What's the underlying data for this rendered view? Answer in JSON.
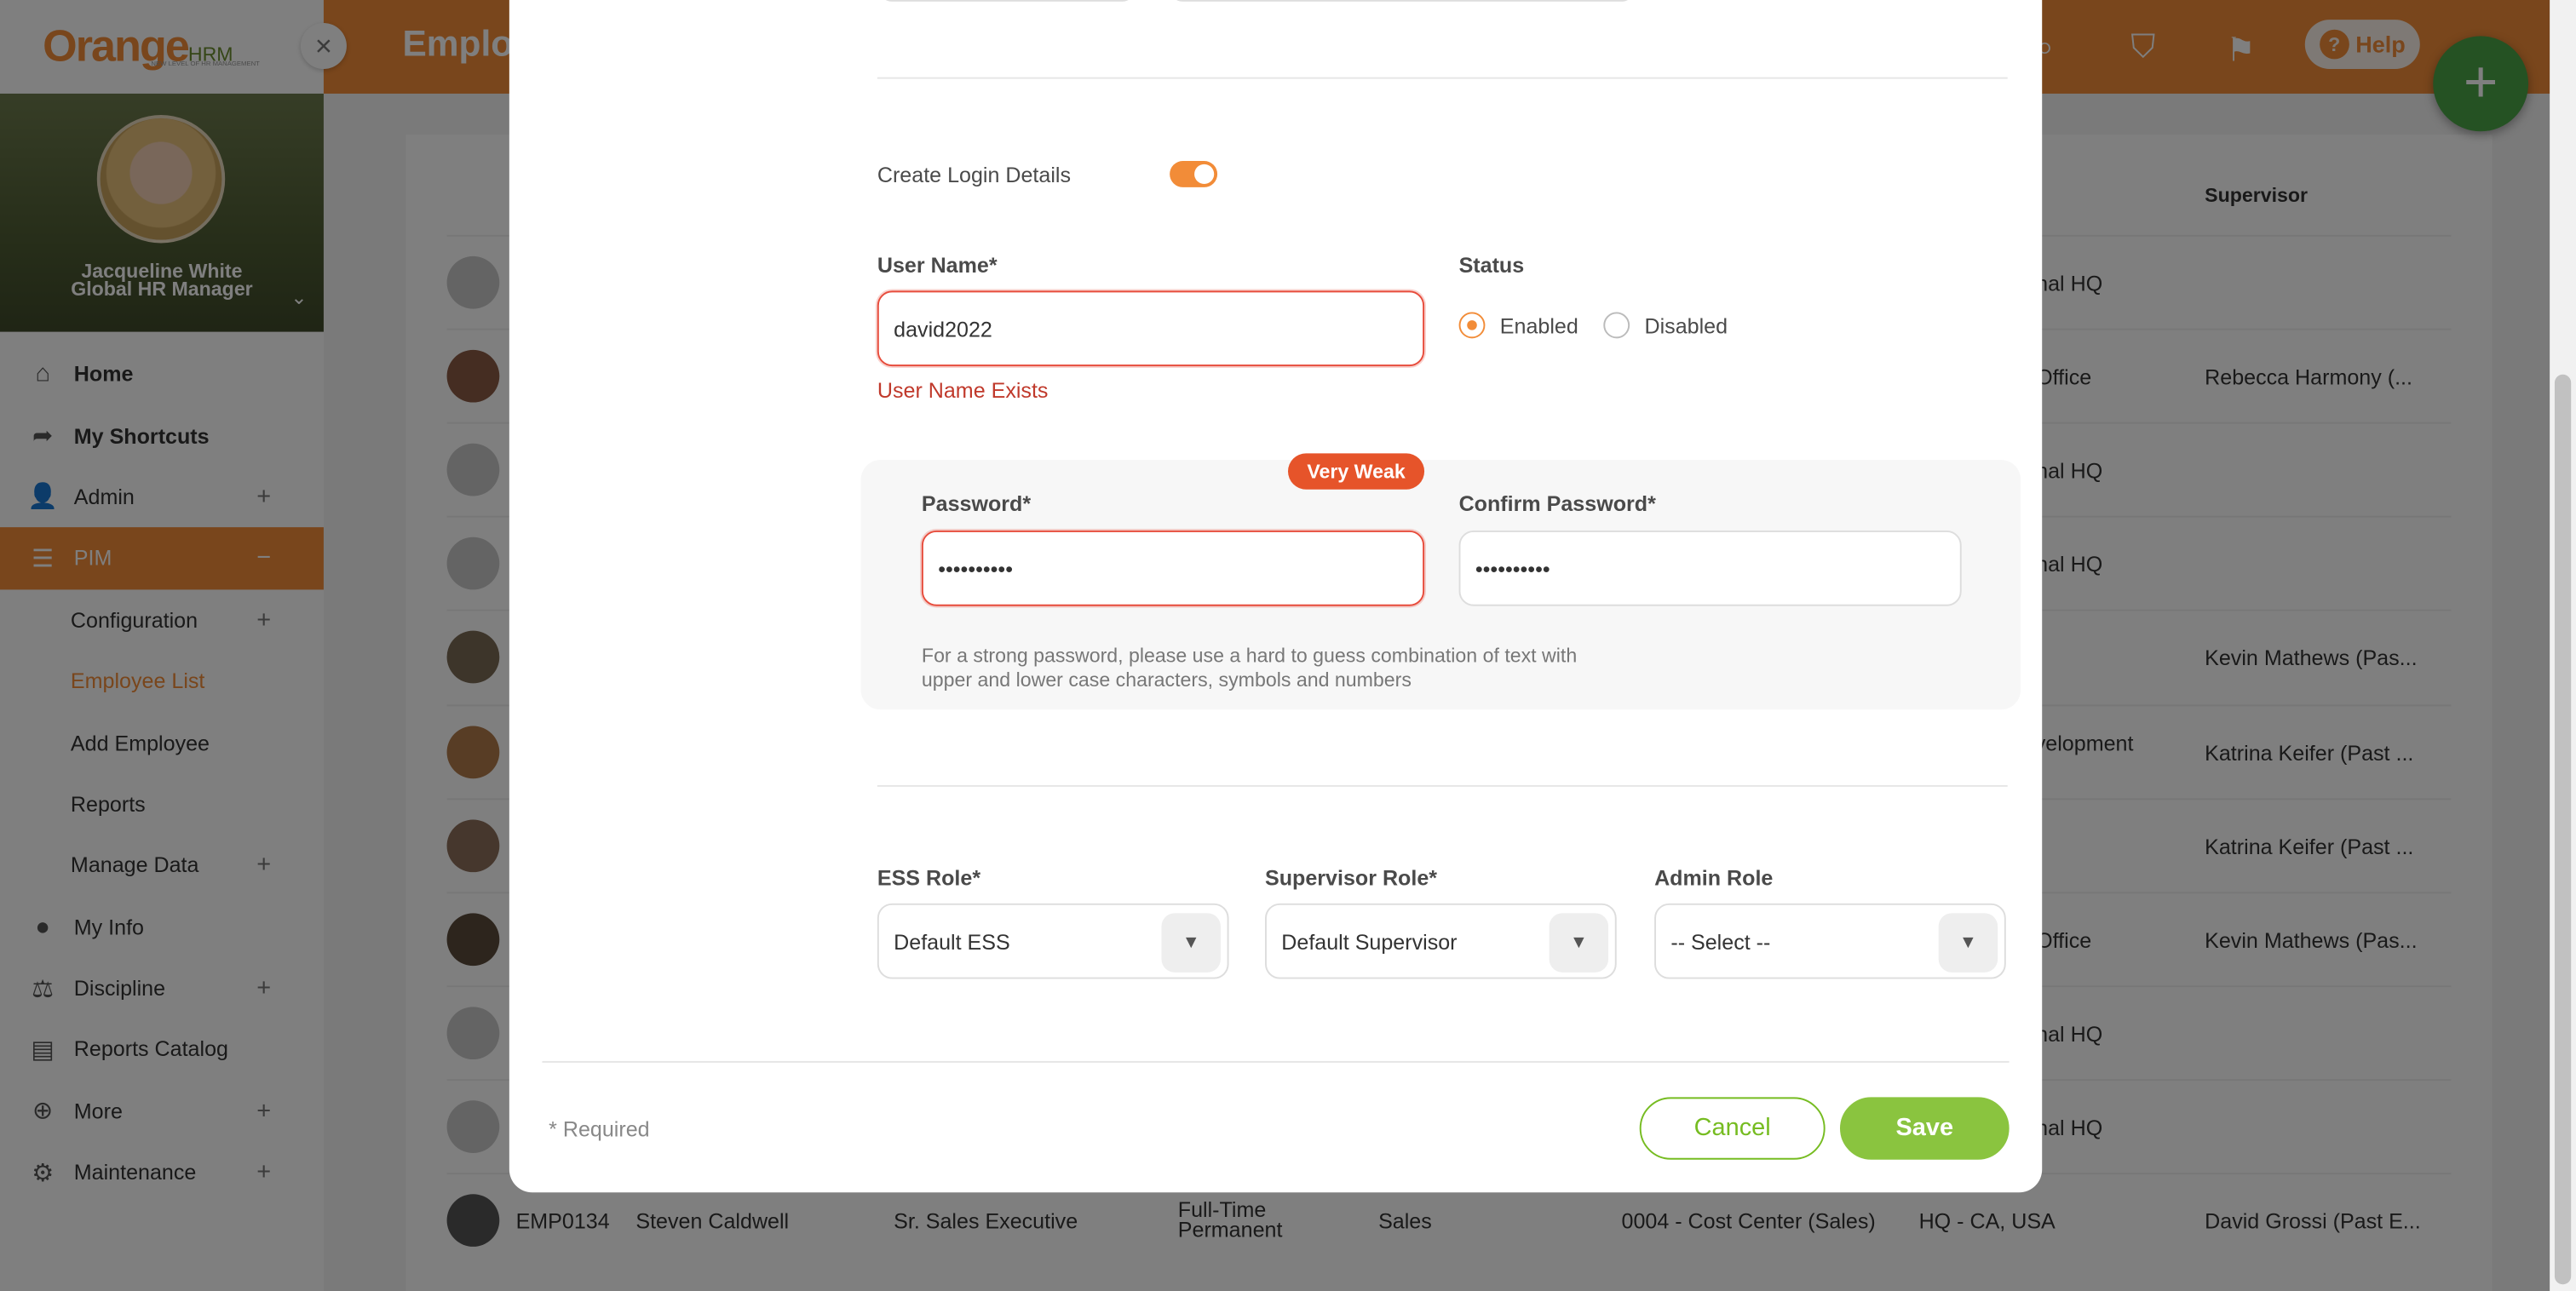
{
  "sidebar": {
    "logo": {
      "brand_orange": "Orange",
      "brand_hrm": "HRM",
      "tagline": "NEW LEVEL OF HR MANAGEMENT"
    },
    "profile": {
      "name": "Jacqueline White",
      "role": "Global HR Manager"
    },
    "items": [
      {
        "label": "Home",
        "icon": "home-icon"
      },
      {
        "label": "My Shortcuts",
        "icon": "share-icon"
      },
      {
        "label": "Admin",
        "icon": "admin-icon"
      },
      {
        "label": "PIM",
        "icon": "pim-icon"
      },
      {
        "label": "Configuration"
      },
      {
        "label": "Employee List"
      },
      {
        "label": "Add Employee"
      },
      {
        "label": "Reports"
      },
      {
        "label": "Manage Data"
      },
      {
        "label": "My Info",
        "icon": "user-icon"
      },
      {
        "label": "Discipline",
        "icon": "discipline-icon"
      },
      {
        "label": "Reports Catalog",
        "icon": "document-icon"
      },
      {
        "label": "More",
        "icon": "plus-circle-icon"
      },
      {
        "label": "Maintenance",
        "icon": "gear-icon"
      }
    ]
  },
  "header": {
    "title": "Employ",
    "help_label": "Help"
  },
  "background_table": {
    "supervisor_header": "Supervisor",
    "rows": [
      {
        "location": "gional HQ",
        "supervisor": ""
      },
      {
        "location": "es Office",
        "supervisor": "Rebecca Harmony (..."
      },
      {
        "location": "gional HQ",
        "supervisor": ""
      },
      {
        "location": "gional HQ",
        "supervisor": ""
      },
      {
        "location": "",
        "supervisor": "Kevin Mathews (Pas..."
      },
      {
        "location": " Development",
        "supervisor": "Katrina Keifer (Past ..."
      },
      {
        "location": "",
        "supervisor": "Katrina Keifer (Past ..."
      },
      {
        "location": "es Office",
        "supervisor": "Kevin Mathews (Pas..."
      },
      {
        "location": "gional HQ",
        "supervisor": ""
      },
      {
        "location": "gional HQ",
        "supervisor": ""
      }
    ],
    "last_row": {
      "id": "EMP0134",
      "name": "Steven Caldwell",
      "job_title": "Sr. Sales Executive",
      "employment_status": "Full-Time Permanent",
      "sub_unit": "Sales",
      "cost_center": "0004 - Cost Center (Sales)",
      "location": "HQ - CA, USA",
      "supervisor": "David Grossi (Past E..."
    }
  },
  "modal": {
    "create_login_label": "Create Login Details",
    "create_login_enabled": true,
    "username": {
      "label": "User Name*",
      "value": "david2022",
      "error": "User Name Exists"
    },
    "status": {
      "label": "Status",
      "options": [
        "Enabled",
        "Disabled"
      ],
      "selected": "Enabled"
    },
    "password": {
      "label": "Password*",
      "value": "••••••••••",
      "strength": "Very Weak"
    },
    "confirm_password": {
      "label": "Confirm Password*",
      "value": "••••••••••"
    },
    "password_hint": "For a strong password, please use a hard to guess combination of text with upper and lower case characters, symbols and numbers",
    "ess_role": {
      "label": "ESS Role*",
      "value": "Default ESS"
    },
    "supervisor_role": {
      "label": "Supervisor Role*",
      "value": "Default Supervisor"
    },
    "admin_role": {
      "label": "Admin Role",
      "value": "-- Select --"
    },
    "required_note": "* Required",
    "cancel_label": "Cancel",
    "save_label": "Save"
  },
  "colors": {
    "accent": "#f28c38",
    "error": "#e74c3c",
    "save": "#8ac43f",
    "fab": "#4aa547"
  }
}
